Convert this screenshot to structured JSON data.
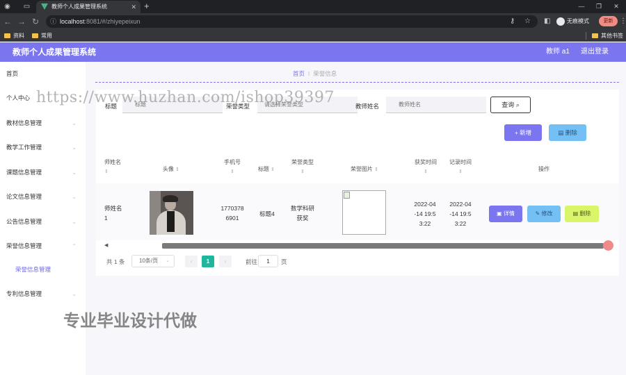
{
  "browser": {
    "tab_title": "教师个人成果管理系统",
    "url_host": "localhost",
    "url_path": ":8081/#/zhiyepeixun",
    "incognito_label": "无痕模式",
    "update_label": "更新",
    "bookmarks": [
      "资料",
      "常用"
    ],
    "other_bookmarks": "其他书签"
  },
  "app": {
    "title": "教师个人成果管理系统",
    "user": "教师 a1",
    "logout": "退出登录"
  },
  "sidebar": {
    "items": [
      {
        "label": "首页"
      },
      {
        "label": "个人中心"
      },
      {
        "label": "教材信息管理"
      },
      {
        "label": "教学工作管理"
      },
      {
        "label": "课题信息管理"
      },
      {
        "label": "论文信息管理"
      },
      {
        "label": "公告信息管理"
      },
      {
        "label": "荣誉信息管理"
      },
      {
        "label": "荣誉信息管理"
      },
      {
        "label": "专利信息管理"
      }
    ]
  },
  "breadcrumb": {
    "home": "首页",
    "current": "荣誉信息"
  },
  "search": {
    "title_label": "标题",
    "title_placeholder": "标题",
    "type_label": "荣誉类型",
    "type_placeholder": "请选择荣誉类型",
    "teacher_label": "教师姓名",
    "teacher_placeholder": "教师姓名",
    "query_button": "查询"
  },
  "actions": {
    "add": "新增",
    "delete": "删除"
  },
  "table": {
    "headers": [
      "师姓名",
      "头像",
      "手机号",
      "标题",
      "荣誉类型",
      "荣誉图片",
      "获奖时间",
      "记录时间",
      "操作"
    ],
    "row": {
      "teacher": "师姓名\n1",
      "phone": "1770378\n6901",
      "title": "标题4",
      "type": "数学科研\n获奖",
      "award_time": "2022-04\n-14 19:5\n3:22",
      "record_time": "2022-04\n-14 19:5\n3:22",
      "detail": "详情",
      "edit": "修改",
      "remove": "删除"
    }
  },
  "pagination": {
    "total": "共 1 条",
    "page_size": "10条/页",
    "current_page": "1",
    "goto_label": "前往",
    "goto_value": "1",
    "page_suffix": "页"
  },
  "watermarks": {
    "url": "https://www.huzhan.com/ishop39397",
    "text": "专业毕业设计代做"
  }
}
